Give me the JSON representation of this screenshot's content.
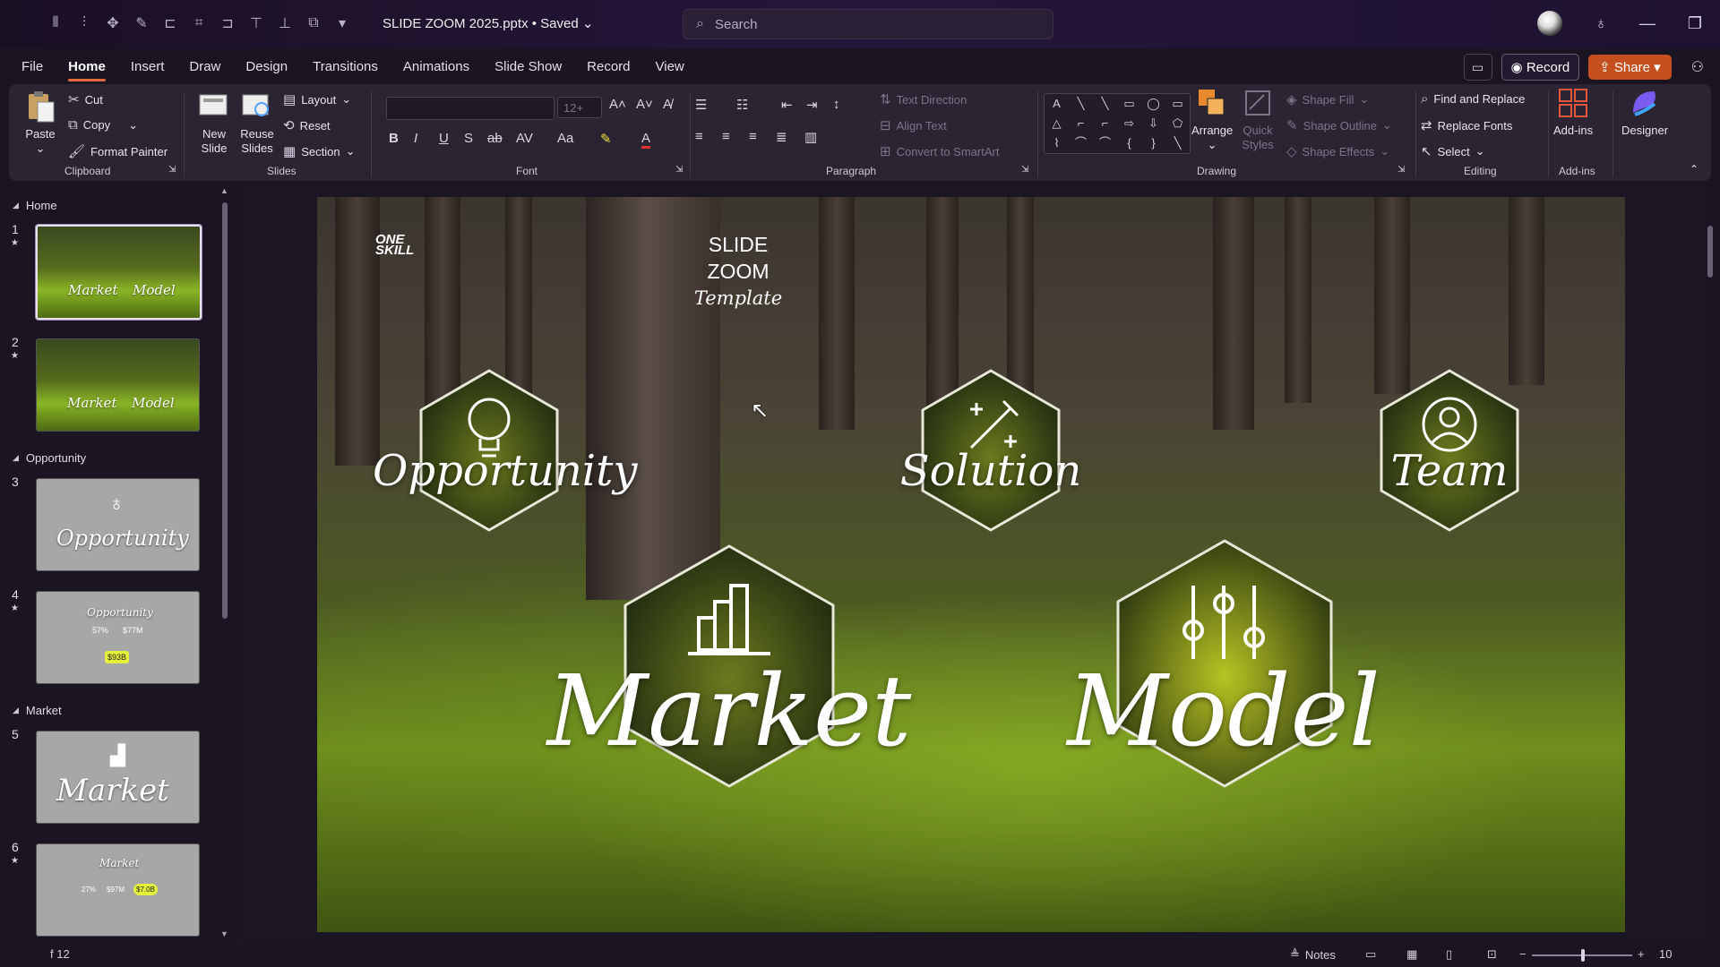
{
  "titlebar": {
    "doc_title": "SLIDE ZOOM 2025.pptx • Saved",
    "search_placeholder": "Search"
  },
  "tabs": [
    "File",
    "Home",
    "Insert",
    "Draw",
    "Design",
    "Transitions",
    "Animations",
    "Slide Show",
    "Record",
    "View"
  ],
  "active_tab": "Home",
  "tab_right": {
    "record": "Record",
    "share": "Share"
  },
  "ribbon": {
    "clipboard": {
      "paste": "Paste",
      "cut": "Cut",
      "copy": "Copy",
      "format_painter": "Format Painter",
      "label": "Clipboard"
    },
    "slides": {
      "new_slide": "New Slide",
      "reuse_slides": "Reuse Slides",
      "layout": "Layout",
      "reset": "Reset",
      "section": "Section",
      "label": "Slides"
    },
    "font": {
      "size": "12+",
      "label": "Font"
    },
    "paragraph": {
      "text_direction": "Text Direction",
      "align_text": "Align Text",
      "convert_smartart": "Convert to SmartArt",
      "label": "Paragraph"
    },
    "drawing": {
      "arrange": "Arrange",
      "quick_styles": "Quick Styles",
      "shape_fill": "Shape Fill",
      "shape_outline": "Shape Outline",
      "shape_effects": "Shape Effects",
      "label": "Drawing"
    },
    "editing": {
      "find_replace": "Find and Replace",
      "replace_fonts": "Replace Fonts",
      "select": "Select",
      "label": "Editing"
    },
    "addins": {
      "addins": "Add-ins",
      "designer": "Designer",
      "label": "Add-ins"
    }
  },
  "sections": [
    {
      "name": "Home"
    },
    {
      "name": "Opportunity"
    },
    {
      "name": "Market"
    }
  ],
  "thumbs": [
    {
      "num": "1",
      "star": "★",
      "labels": [
        "Market",
        "Model"
      ]
    },
    {
      "num": "2",
      "star": "★",
      "labels": [
        "Market",
        "Model"
      ]
    },
    {
      "num": "3",
      "label": "Opportunity"
    },
    {
      "num": "4",
      "star": "★",
      "label": "Opportunity",
      "stats": [
        "57%",
        "$77M",
        "$93B"
      ]
    },
    {
      "num": "5",
      "label": "Market"
    },
    {
      "num": "6",
      "star": "★",
      "label": "Market",
      "stats": [
        "27%",
        "$97M",
        "$7.0B"
      ]
    }
  ],
  "slide": {
    "logo": "ONE SKILL",
    "title_line1": "SLIDE",
    "title_line2": "ZOOM",
    "title_sub": "Template",
    "hexes": [
      "Opportunity",
      "Solution",
      "Team",
      "Market",
      "Model"
    ]
  },
  "statusbar": {
    "slide_count": "f 12",
    "notes": "Notes",
    "zoom": "10"
  },
  "colors": {
    "accent": "#e06a3e",
    "share": "#c4501f"
  }
}
